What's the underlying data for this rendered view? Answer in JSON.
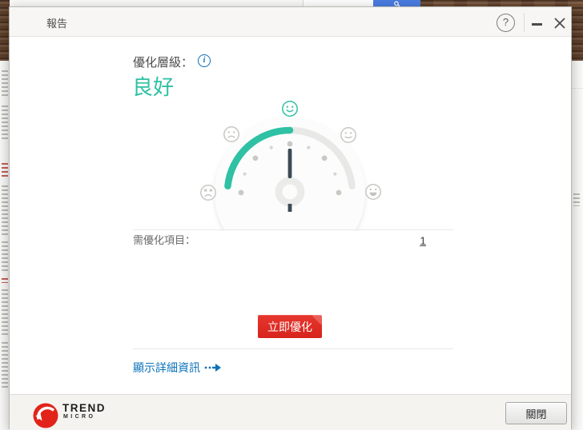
{
  "window": {
    "title": "報告",
    "controls": {
      "help_glyph": "?"
    }
  },
  "report": {
    "level_label": "優化層級：",
    "level_value": "良好",
    "items_label": "需優化項目：",
    "items_count": "1",
    "optimize_button_label": "立即優化",
    "details_link_label": "顯示詳細資訊"
  },
  "gauge": {
    "type": "mood-dial",
    "needle_position": "top-center",
    "active_mood": "good",
    "moods": [
      "angry",
      "sad",
      "good",
      "okay",
      "great"
    ],
    "filled_side": "left",
    "arc_filled_color": "#2fc1a3",
    "arc_empty_color": "#e8e8e6",
    "needle_color": "#3e4a56"
  },
  "icons": {
    "info": "i",
    "help": "question-mark-circle",
    "minimize": "minimize-bar",
    "close": "x-cross",
    "details_arrow": "dotted-right-arrow",
    "brand_logo": "trend-micro-red-ball",
    "background_search": "magnifier"
  },
  "footer": {
    "brand_top": "TREND",
    "brand_bottom": "MICRO",
    "close_button_label": "關閉"
  },
  "colors": {
    "accent_teal": "#2fc1a3",
    "danger_red": "#dd2a22",
    "link_blue": "#0b72ba",
    "titlebar_bg": "#f7f6f4",
    "footer_bg": "#f4f3f0",
    "wood_brown": "#6e4b32",
    "search_button_blue": "#4a7de2"
  }
}
